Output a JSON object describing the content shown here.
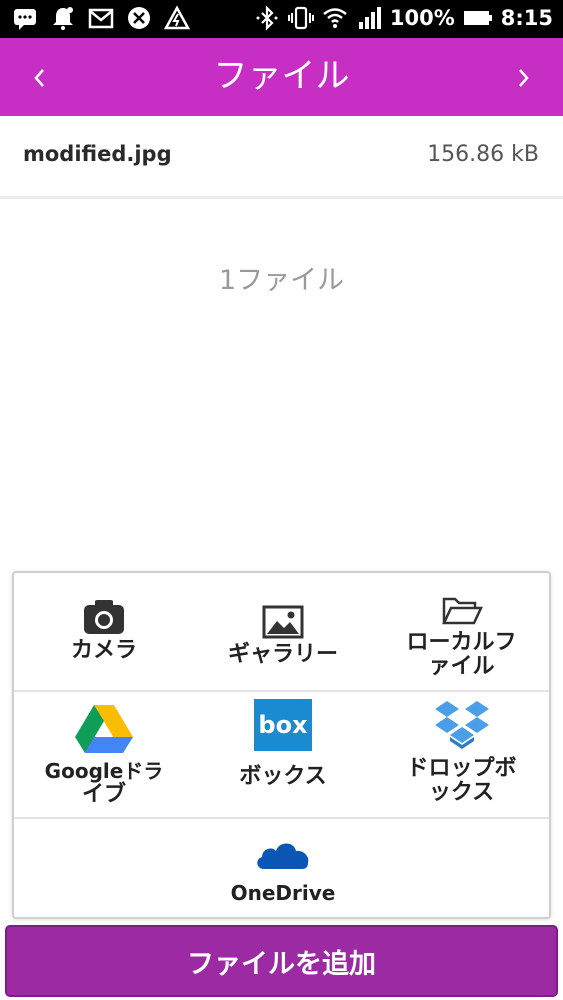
{
  "status_bar": {
    "battery": "100%",
    "time": "8:15",
    "icons": [
      "message-icon",
      "notification-bell-icon",
      "gmail-icon",
      "sync-icon",
      "alert-icon",
      "bluetooth-icon",
      "vibrate-icon",
      "wifi-icon",
      "signal-icon",
      "battery-icon"
    ]
  },
  "header": {
    "title": "ファイル",
    "prev_icon": "chevron-left-icon",
    "next_icon": "chevron-right-icon",
    "accent": "#c72fc4"
  },
  "file": {
    "name": "modified.jpg",
    "size": "156.86 kB"
  },
  "file_count": "1ファイル",
  "sources": [
    {
      "label": "カメラ",
      "icon": "camera-icon"
    },
    {
      "label": "ギャラリー",
      "icon": "gallery-icon"
    },
    {
      "label_lines": [
        "ローカルフ",
        "ァイル"
      ],
      "icon": "folder-icon"
    },
    {
      "label_lines": [
        "Googleドラ",
        "イブ"
      ],
      "icon": "google-drive-icon"
    },
    {
      "label": "ボックス",
      "icon": "box-icon"
    },
    {
      "label_lines": [
        "ドロップボ",
        "ックス"
      ],
      "icon": "dropbox-icon"
    },
    {
      "label": "OneDrive",
      "icon": "onedrive-icon"
    }
  ],
  "add_button": {
    "label": "ファイルを追加",
    "color": "#9b2aa3"
  }
}
